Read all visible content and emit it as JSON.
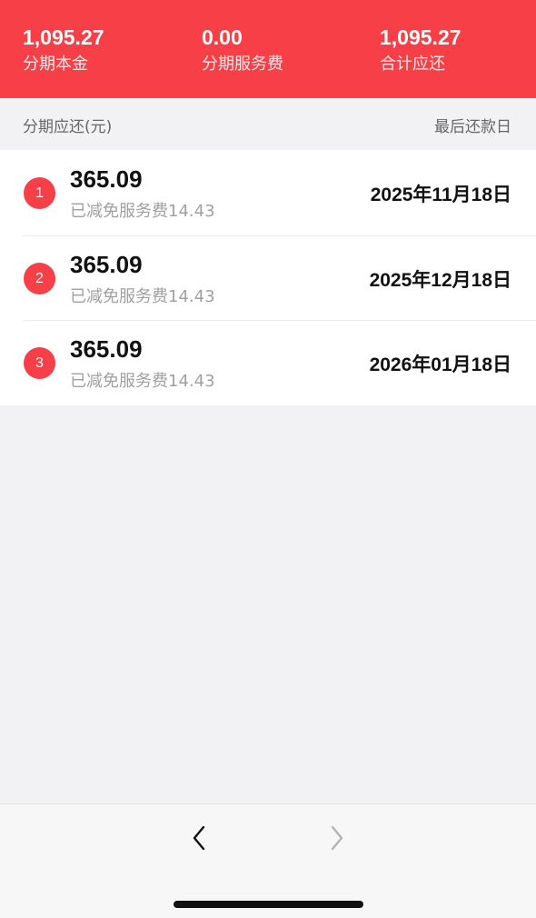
{
  "summary": {
    "principal": {
      "value": "1,095.27",
      "label": "分期本金"
    },
    "service_fee": {
      "value": "0.00",
      "label": "分期服务费"
    },
    "total": {
      "value": "1,095.27",
      "label": "合计应还"
    }
  },
  "header": {
    "left": "分期应还(元)",
    "right": "最后还款日"
  },
  "installments": [
    {
      "index": "1",
      "amount": "365.09",
      "waived": "已减免服务费14.43",
      "due_date": "2025年11月18日"
    },
    {
      "index": "2",
      "amount": "365.09",
      "waived": "已减免服务费14.43",
      "due_date": "2025年12月18日"
    },
    {
      "index": "3",
      "amount": "365.09",
      "waived": "已减免服务费14.43",
      "due_date": "2026年01月18日"
    }
  ],
  "navigation": {
    "back_icon": "chevron-left-icon",
    "forward_icon": "chevron-right-icon"
  },
  "colors": {
    "accent": "#f73f47",
    "background": "#f2f2f4"
  }
}
